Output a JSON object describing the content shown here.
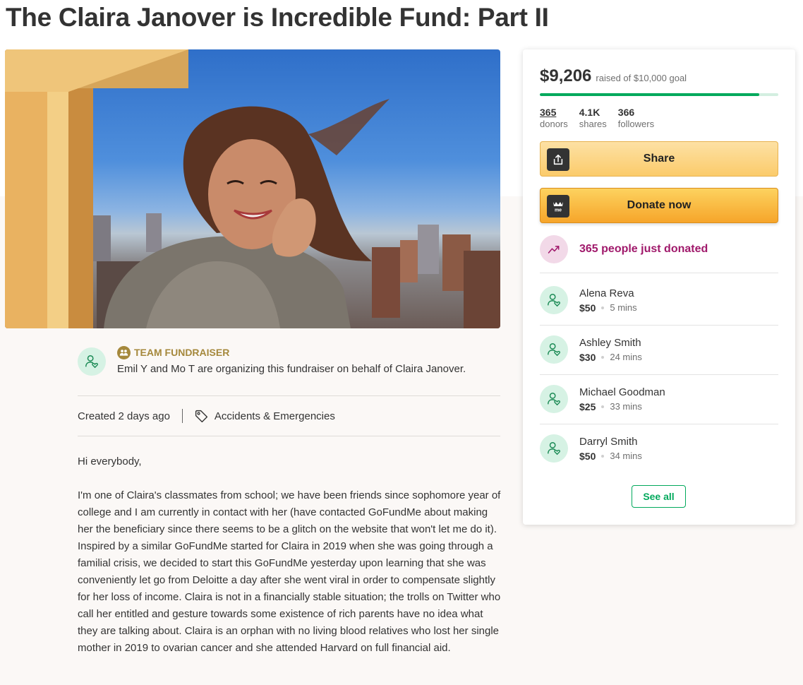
{
  "page": {
    "title": "The Claira Janover is Incredible Fund: Part II"
  },
  "campaign": {
    "image_alt": "Photo of Claira Janover smiling by a sunlit window with a city skyline behind her",
    "organizer": {
      "badge_icon": "team-icon",
      "badge_label": "TEAM FUNDRAISER",
      "text": "Emil Y and Mo T are organizing this fundraiser on behalf of Claira Janover."
    },
    "meta": {
      "created": "Created 2 days ago",
      "category_icon": "tag-icon",
      "category": "Accidents & Emergencies"
    },
    "story": [
      "Hi everybody,",
      "I'm one of Claira's classmates from school; we have been friends since sophomore year of college and I am currently in contact with her (have contacted GoFundMe about making her the beneficiary since there seems to be a glitch on the website that won't let me do it). Inspired by a similar GoFundMe started for Claira in 2019 when she was going through a familial crisis, we decided to start this GoFundMe yesterday upon learning that she was conveniently let go from Deloitte a day after she went viral in order to compensate slightly for her loss of income. Claira is not in a financially stable situation; the trolls on Twitter who call her entitled and gesture towards some existence of rich parents have no idea what they are talking about. Claira is an orphan with no living blood relatives who lost her single mother in 2019 to ovarian cancer and she attended Harvard on full financial aid."
    ]
  },
  "donation_card": {
    "raised_amount": "$9,206",
    "raised_label": "raised of $10,000 goal",
    "progress_fraction": 0.9206,
    "progress_color": "#02a95c",
    "stats": [
      {
        "value": "365",
        "label": "donors"
      },
      {
        "value": "4.1K",
        "label": "shares"
      },
      {
        "value": "366",
        "label": "followers"
      }
    ],
    "share_label": "Share",
    "share_icon": "share-upload-icon",
    "donate_label": "Donate now",
    "donate_icon": "gofundme-logo-icon",
    "just_donated": "365 people just donated",
    "donors": [
      {
        "name": "Alena Reva",
        "amount": "$50",
        "time": "5 mins"
      },
      {
        "name": "Ashley Smith",
        "amount": "$30",
        "time": "24 mins"
      },
      {
        "name": "Michael Goodman",
        "amount": "$25",
        "time": "33 mins"
      },
      {
        "name": "Darryl Smith",
        "amount": "$50",
        "time": "34 mins"
      }
    ],
    "see_all_label": "See all",
    "accent_color": "#02a95c",
    "trend_color": "#a0196b"
  }
}
